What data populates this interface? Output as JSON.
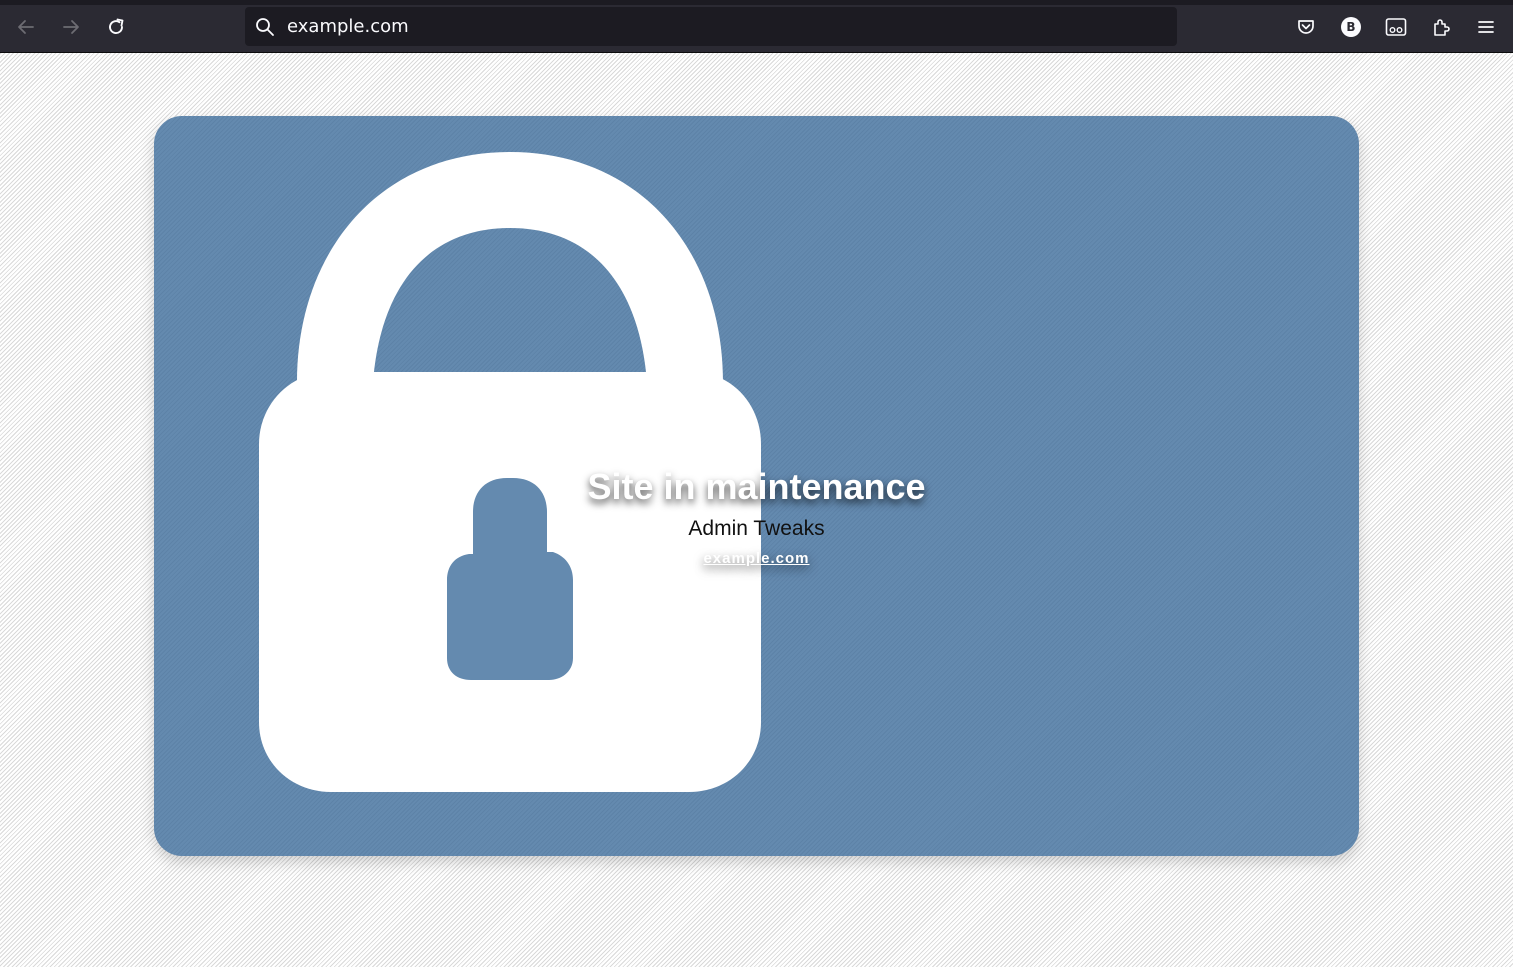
{
  "browser": {
    "url": "example.com",
    "toolbar_icons": [
      "back-arrow-icon",
      "forward-arrow-icon",
      "reload-icon",
      "search-icon",
      "pocket-icon",
      "account-icon",
      "reader-icon",
      "extensions-icon",
      "menu-icon"
    ],
    "account_initial": "B"
  },
  "page": {
    "title": "Site in maintenance",
    "subtitle": "Admin Tweaks",
    "link_text": "example.com",
    "colors": {
      "card": "#648aaf",
      "lock": "#ffffff",
      "chrome": "#2b2a33",
      "urlbar": "#1c1b22"
    },
    "graphic": "padlock-icon"
  }
}
